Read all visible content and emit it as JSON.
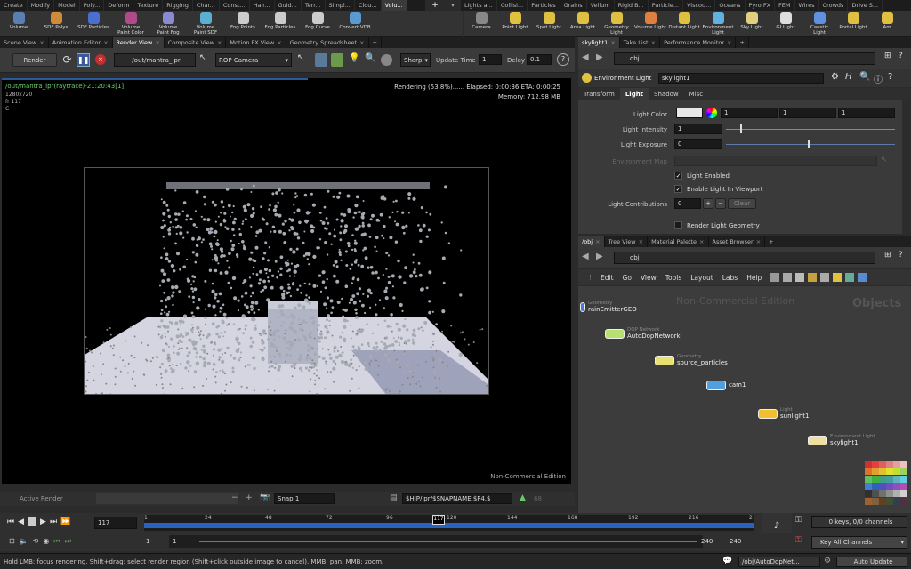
{
  "shelf_tabs_left": [
    "Create",
    "Modify",
    "Model",
    "Poly...",
    "Deform",
    "Texture",
    "Rigging",
    "Char...",
    "Const...",
    "Hair...",
    "Guid...",
    "Terr...",
    "Simpl...",
    "Clou...",
    "Volu..."
  ],
  "shelf_tabs_right": [
    "Lights a...",
    "Collisi...",
    "Particles",
    "Grains",
    "Vellum",
    "Rigid B...",
    "Particle...",
    "Viscou...",
    "Oceans",
    "Pyro FX",
    "FEM",
    "Wires",
    "Crowds",
    "Drive S..."
  ],
  "tools_left": [
    {
      "label": "Volume",
      "color": "#5a7fb0"
    },
    {
      "label": "SDF Polys",
      "color": "#d08a3a"
    },
    {
      "label": "SDF Particles",
      "color": "#4a6fd0"
    },
    {
      "label": "Volume\nPaint Color",
      "color": "#b04a8a"
    },
    {
      "label": "Volume\nPaint Fog",
      "color": "#8a8ad0"
    },
    {
      "label": "Volume\nPaint SDF",
      "color": "#5ab0d0"
    },
    {
      "label": "Fog Points",
      "color": "#cccccc"
    },
    {
      "label": "Fog Particles",
      "color": "#cccccc"
    },
    {
      "label": "Fog Curve",
      "color": "#cccccc"
    },
    {
      "label": "Convert VDB",
      "color": "#5a9ad0"
    }
  ],
  "tools_right": [
    {
      "label": "Camera",
      "color": "#888"
    },
    {
      "label": "Point Light",
      "color": "#e0c040"
    },
    {
      "label": "Spot Light",
      "color": "#e0c040"
    },
    {
      "label": "Area Light",
      "color": "#e0c040"
    },
    {
      "label": "Geometry\nLight",
      "color": "#e0c040"
    },
    {
      "label": "Volume Light",
      "color": "#e08040"
    },
    {
      "label": "Distant Light",
      "color": "#e0c040"
    },
    {
      "label": "Environment\nLight",
      "color": "#60b0e0"
    },
    {
      "label": "Sky Light",
      "color": "#e0d080"
    },
    {
      "label": "GI Light",
      "color": "#dddddd"
    },
    {
      "label": "Caustic\nLight",
      "color": "#6090e0"
    },
    {
      "label": "Portal Light",
      "color": "#e0c040"
    },
    {
      "label": "Am",
      "color": "#e0c040"
    }
  ],
  "left_tabs": [
    "Scene View",
    "Animation Editor",
    "Render View",
    "Composite View",
    "Motion FX View",
    "Geometry Spreadsheet"
  ],
  "render_toolbar": {
    "render": "Render",
    "rop_path": "/out/mantra_ipr",
    "camera": "ROP Camera",
    "sharp": "Sharp",
    "update_label": "Update Time",
    "update_value": "1",
    "delay_label": "Delay",
    "delay_value": "0.1"
  },
  "viewport": {
    "header": "/out/mantra_ipr(raytrace)-21:20:43[1]",
    "res": "1280x720",
    "frame": "fr 117",
    "channel": "C",
    "status": "Rendering (53.8%)...... Elapsed: 0:00:36   ETA: 0:00:25",
    "memory": "Memory:    712.98 MB",
    "watermark": "Non-Commercial Edition"
  },
  "snap_bar": {
    "active": "Active Render",
    "snap": "Snap  1",
    "path": "$HIP/ipr/$SNAPNAME.$F4.$",
    "num": "68"
  },
  "timeline": {
    "frame": "117",
    "ticks": [
      "1",
      "24",
      "48",
      "72",
      "96",
      "120",
      "144",
      "168",
      "192",
      "216",
      "2"
    ],
    "current": "117",
    "start": "1",
    "start2": "1",
    "end": "240",
    "end2": "240",
    "keys": "0 keys, 0/0 channels",
    "keyall": "Key All Channels"
  },
  "status_bar": {
    "text": "Hold LMB: focus rendering. Shift+drag: select render region (Shift+click outside image to cancel). MMB: pan. MMB: zoom.",
    "path": "/obj/AutoDopNet...",
    "update": "Auto Update"
  },
  "param_tabs": [
    "skylight1",
    "Take List",
    "Performance Monitor"
  ],
  "param": {
    "path": "obj",
    "node_type": "Environment Light",
    "node_name": "skylight1",
    "tabs": [
      "Transform",
      "Light",
      "Shadow",
      "Misc"
    ],
    "color_label": "Light Color",
    "color_vals": [
      "1",
      "1",
      "1"
    ],
    "intensity_label": "Light Intensity",
    "intensity_val": "1",
    "exposure_label": "Light Exposure",
    "exposure_val": "0",
    "envmap_label": "Environment Map",
    "enabled_label": "Light Enabled",
    "viewport_label": "Enable Light In Viewport",
    "contrib_label": "Light Contributions",
    "contrib_val": "0",
    "clear": "Clear",
    "render_geo_label": "Render Light Geometry"
  },
  "network_tabs": [
    "/obj",
    "Tree View",
    "Material Palette",
    "Asset Browser"
  ],
  "network": {
    "path": "obj",
    "menu": [
      "Edit",
      "Go",
      "View",
      "Tools",
      "Layout",
      "Labs",
      "Help"
    ],
    "watermark": "Non-Commercial Edition",
    "context": "Objects",
    "nodes": [
      {
        "type": "Geometry",
        "name": "rainEmitterGEO",
        "color": "#4a7ad0"
      },
      {
        "type": "DOP Network",
        "name": "AutoDopNetwork",
        "color": "#b8e070"
      },
      {
        "type": "Geometry",
        "name": "source_particles",
        "color": "#e8e070"
      },
      {
        "type": "",
        "name": "cam1",
        "color": "#50a0e0"
      },
      {
        "type": "Light",
        "name": "sunlight1",
        "color": "#f0c030"
      },
      {
        "type": "Environment Light",
        "name": "skylight1",
        "color": "#f0e0a0"
      }
    ]
  },
  "palette": [
    "#d03030",
    "#e04040",
    "#e06060",
    "#e08080",
    "#e0a0a0",
    "#f0c0c0",
    "#e07030",
    "#e0a030",
    "#e0c030",
    "#e0e030",
    "#c0e030",
    "#a0d060",
    "#60c060",
    "#40b040",
    "#40a080",
    "#40a0a0",
    "#60b0c0",
    "#60d0e0",
    "#4080d0",
    "#3060c0",
    "#5050c0",
    "#7050c0",
    "#9050c0",
    "#b050b0",
    "#303030",
    "#505050",
    "#707070",
    "#909090",
    "#b0b0b0",
    "#d0d0d0",
    "#a06030",
    "#806040",
    "#604020",
    "#405030",
    "#304050",
    "#503040"
  ]
}
